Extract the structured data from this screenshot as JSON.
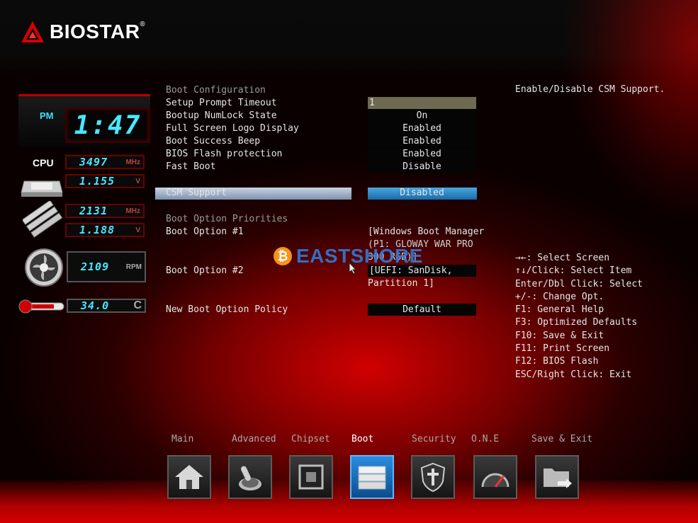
{
  "brand": {
    "name": "BIOSTAR",
    "reg": "®"
  },
  "clock": {
    "ampm": "PM",
    "time": "1:47"
  },
  "monitors": {
    "cpu_label": "CPU",
    "cpu_freq": "3497",
    "cpu_freq_unit": "MHz",
    "cpu_volt": "1.155",
    "cpu_volt_unit": "V",
    "mem_freq": "2131",
    "mem_freq_unit": "MHz",
    "mem_volt": "1.188",
    "mem_volt_unit": "V",
    "fan_rpm": "2109",
    "fan_unit": "RPM",
    "temp": "34.0",
    "temp_unit": "C"
  },
  "settings": {
    "boot_config_header": "Boot Configuration",
    "setup_prompt_timeout": {
      "label": "Setup Prompt Timeout",
      "value": "1"
    },
    "bootup_numlock": {
      "label": "Bootup NumLock State",
      "value": "On"
    },
    "full_screen_logo": {
      "label": "Full Screen Logo Display",
      "value": "Enabled"
    },
    "boot_success_beep": {
      "label": "Boot Success Beep",
      "value": "Enabled"
    },
    "bios_flash_protection": {
      "label": "BIOS Flash protection",
      "value": "Enabled"
    },
    "fast_boot": {
      "label": "Fast Boot",
      "value": "Disable"
    },
    "csm_support": {
      "label": "CSM Support",
      "value": "Disabled"
    },
    "boot_priorities_header": "Boot Option Priorities",
    "boot_option_1": {
      "label": "Boot Option #1",
      "value_line1": "[Windows Boot Manager",
      "value_line2": "(P1: GLOWAY WAR PRO",
      "value_line3": "300 RGB)]"
    },
    "boot_option_2": {
      "label": "Boot Option #2",
      "value_line1": "[UEFI: SanDisk,",
      "value_line2": "Partition 1]"
    },
    "new_boot_option_policy": {
      "label": "New Boot Option Policy",
      "value": "Default"
    }
  },
  "help": {
    "description": "Enable/Disable CSM Support.",
    "keys": [
      "→←: Select Screen",
      "↑↓/Click: Select Item",
      "Enter/Dbl Click: Select",
      "+/-: Change Opt.",
      "F1: General Help",
      "F3: Optimized Defaults",
      "F10: Save & Exit",
      "F11: Print Screen",
      "F12: BIOS Flash",
      "ESC/Right Click: Exit"
    ]
  },
  "watermark": {
    "coin": "₿",
    "text": "EASTSHORE"
  },
  "tabs": [
    {
      "label": "Main",
      "icon": "home-icon"
    },
    {
      "label": "Advanced",
      "icon": "joystick-icon"
    },
    {
      "label": "Chipset",
      "icon": "chip-icon"
    },
    {
      "label": "Boot",
      "icon": "drive-icon"
    },
    {
      "label": "Security",
      "icon": "shield-icon"
    },
    {
      "label": "O.N.E",
      "icon": "speedometer-icon"
    },
    {
      "label": "Save & Exit",
      "icon": "folder-exit-icon"
    }
  ],
  "active_tab": "Boot"
}
